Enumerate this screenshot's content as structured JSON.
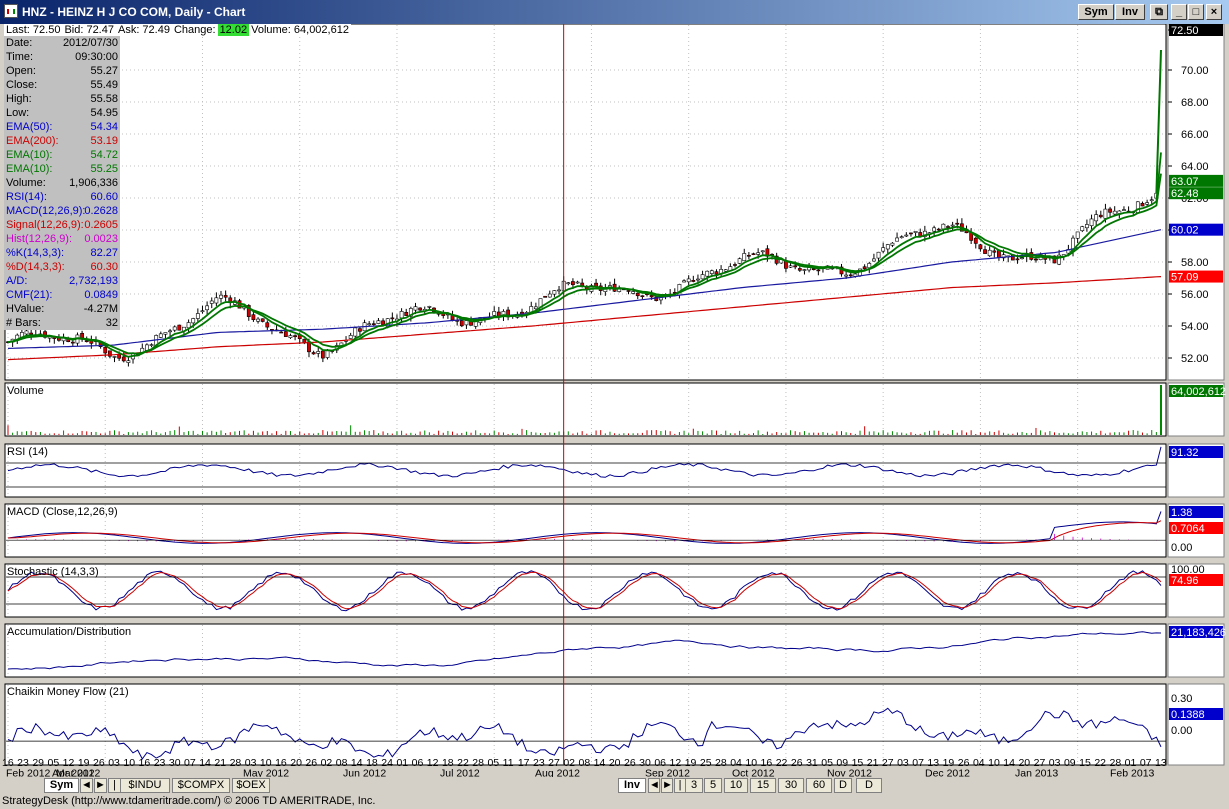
{
  "window": {
    "title": "HNZ - HEINZ H J CO COM, Daily - Chart",
    "buttons": [
      "Sym",
      "Inv"
    ]
  },
  "quote": {
    "last": "Last: 72.50",
    "bid": "Bid: 72.47",
    "ask": "Ask: 72.49",
    "change_label": "Change:",
    "change_value": "12.02",
    "volume": "Volume: 64,002,612"
  },
  "info_panel": [
    {
      "k": "Date:",
      "v": "2012/07/30",
      "color": "#000000"
    },
    {
      "k": "Time:",
      "v": "09:30:00",
      "color": "#000000"
    },
    {
      "k": "Open:",
      "v": "55.27",
      "color": "#000000"
    },
    {
      "k": "Close:",
      "v": "55.49",
      "color": "#000000"
    },
    {
      "k": "High:",
      "v": "55.58",
      "color": "#000000"
    },
    {
      "k": "Low:",
      "v": "54.95",
      "color": "#000000"
    },
    {
      "k": "EMA(50):",
      "v": "54.34",
      "color": "#0000cc"
    },
    {
      "k": "EMA(200):",
      "v": "53.19",
      "color": "#cc0000"
    },
    {
      "k": "EMA(10):",
      "v": "54.72",
      "color": "#007700"
    },
    {
      "k": "EMA(10):",
      "v": "55.25",
      "color": "#007700"
    },
    {
      "k": "Volume:",
      "v": "1,906,336",
      "color": "#000000"
    },
    {
      "k": "RSI(14):",
      "v": "60.60",
      "color": "#0000cc"
    },
    {
      "k": "MACD(12,26,9):",
      "v": "0.2628",
      "color": "#0000cc"
    },
    {
      "k": "Signal(12,26,9):",
      "v": "0.2605",
      "color": "#cc0000"
    },
    {
      "k": "Hist(12,26,9):",
      "v": "0.0023",
      "color": "#cc00cc"
    },
    {
      "k": "%K(14,3,3):",
      "v": "82.27",
      "color": "#0000cc"
    },
    {
      "k": "%D(14,3,3):",
      "v": "60.30",
      "color": "#cc0000"
    },
    {
      "k": "A/D:",
      "v": "2,732,193",
      "color": "#0000cc"
    },
    {
      "k": "CMF(21):",
      "v": "0.0849",
      "color": "#0000cc"
    },
    {
      "k": "HValue:",
      "v": "-4.27M",
      "color": "#000000"
    },
    {
      "k": "# Bars:",
      "v": "32",
      "color": "#000000"
    }
  ],
  "tabs": {
    "left": [
      "Sym",
      "$INDU",
      "$COMPX",
      "$OEX"
    ],
    "right": [
      "Inv",
      "3",
      "5",
      "10",
      "15",
      "30",
      "60",
      "D",
      "D"
    ]
  },
  "status": "StrategyDesk (http://www.tdameritrade.com/) © 2006 TD AMERITRADE, Inc.",
  "colors": {
    "up": "#ffffff",
    "down": "#cc0000",
    "ema50": "#1a1aa0",
    "ema200": "#cc0000",
    "ema10": "#007700",
    "price_badge": "#000000",
    "blue_badge": "#0000cc",
    "red_badge": "#ff0000",
    "green_badge": "#007700",
    "change_bg": "#33dd33"
  },
  "chart_data": {
    "type": "line",
    "price_axis": {
      "ticks": [
        "72.50",
        "70.00",
        "68.00",
        "66.00",
        "64.00",
        "62.00",
        "60.00",
        "58.00",
        "56.00",
        "54.00",
        "52.00"
      ],
      "ylim": [
        51.0,
        72.5
      ]
    },
    "x_day_labels": [
      "16",
      "23",
      "29",
      "05",
      "12",
      "19",
      "26",
      "03",
      "10",
      "16",
      "23",
      "30",
      "07",
      "14",
      "21",
      "28",
      "03",
      "10",
      "16",
      "20",
      "26",
      "02",
      "08",
      "14",
      "18",
      "24",
      "01",
      "06",
      "12",
      "18",
      "22",
      "28",
      "05",
      "11",
      "17",
      "23",
      "27",
      "02",
      "08",
      "14",
      "20",
      "26",
      "30",
      "06",
      "12",
      "19",
      "25",
      "28",
      "04",
      "10",
      "16",
      "22",
      "26",
      "31",
      "05",
      "09",
      "15",
      "21",
      "27",
      "03",
      "07",
      "13",
      "19",
      "26",
      "04",
      "10",
      "14",
      "20",
      "27",
      "03",
      "09",
      "15",
      "22",
      "28",
      "01",
      "07",
      "13"
    ],
    "x_month_labels": [
      "Feb 2012",
      "Mar 2012",
      "Apr 2012",
      "May 2012",
      "Jun 2012",
      "Jul 2012",
      "Aug 2012",
      "Sep 2012",
      "Oct 2012",
      "Nov 2012",
      "Dec 2012",
      "Jan 2013",
      "Feb 2013"
    ],
    "panels": [
      {
        "name": "price",
        "badges": [
          "72.50",
          "63.07",
          "62.48",
          "60.02",
          "57.09"
        ]
      },
      {
        "name": "Volume",
        "label": "Volume",
        "badges": [
          "64,002,612"
        ]
      },
      {
        "name": "RSI",
        "label": "RSI (14)",
        "badges": [
          "91.32"
        ]
      },
      {
        "name": "MACD",
        "label": "MACD (Close,12,26,9)",
        "badges": [
          "1.38",
          "0.7064",
          "0.00"
        ]
      },
      {
        "name": "Stochastic",
        "label": "Stochastic (14,3,3)",
        "badges": [
          "100.00",
          "74.96"
        ]
      },
      {
        "name": "AD",
        "label": "Accumulation/Distribution",
        "badges": [
          "21,183,426"
        ]
      },
      {
        "name": "CMF",
        "label": "Chaikin Money Flow (21)",
        "badges": [
          "0.30",
          "0.1388",
          "0.00"
        ]
      }
    ],
    "key_points": {
      "dates": [
        "Feb 2012",
        "Apr 2012",
        "May 2012",
        "Jun 2012",
        "Jul 2012",
        "Aug 2012",
        "Sep 2012",
        "Oct 2012",
        "Nov 2012",
        "Dec 2012",
        "Jan 2013",
        "Feb 2013"
      ],
      "close": [
        53.0,
        52.6,
        55.0,
        53.0,
        54.6,
        55.4,
        56.4,
        57.6,
        58.0,
        59.8,
        58.3,
        72.5
      ],
      "ema50": [
        52.6,
        52.8,
        53.6,
        53.8,
        54.2,
        54.8,
        55.6,
        56.4,
        57.0,
        58.0,
        58.6,
        60.02
      ],
      "ema200": [
        51.9,
        52.2,
        52.7,
        53.0,
        53.5,
        54.0,
        54.6,
        55.2,
        55.8,
        56.4,
        56.7,
        57.09
      ]
    }
  }
}
